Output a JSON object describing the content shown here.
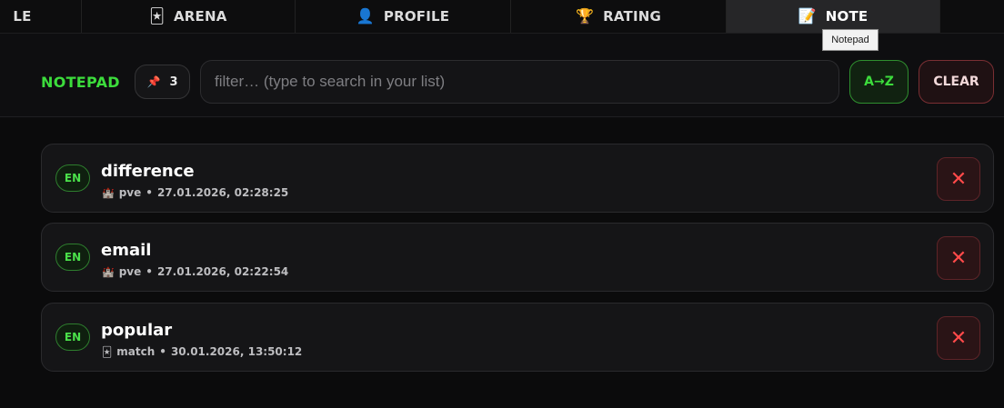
{
  "tabs": [
    {
      "label": "LE",
      "icon": "",
      "active": false
    },
    {
      "label": "ARENA",
      "icon": "🃏",
      "active": false
    },
    {
      "label": "PROFILE",
      "icon": "👤",
      "active": false
    },
    {
      "label": "RATING",
      "icon": "🏆",
      "active": false
    },
    {
      "label": "NOTE",
      "icon": "📝",
      "active": true
    }
  ],
  "tooltip": "Notepad",
  "notepad": {
    "title": "NOTEPAD",
    "count_icon": "📌",
    "count": "3",
    "filter_placeholder": "filter… (type to search in your list)",
    "filter_value": "",
    "sort_label": "A→Z",
    "clear_label": "CLEAR"
  },
  "entries": [
    {
      "lang": "EN",
      "word": "difference",
      "mode_icon": "🏰",
      "mode": "pve",
      "timestamp": "27.01.2026, 02:28:25",
      "delete": "✕"
    },
    {
      "lang": "EN",
      "word": "email",
      "mode_icon": "🏰",
      "mode": "pve",
      "timestamp": "27.01.2026, 02:22:54",
      "delete": "✕"
    },
    {
      "lang": "EN",
      "word": "popular",
      "mode_icon": "🃏",
      "mode": "match",
      "timestamp": "30.01.2026, 13:50:12",
      "delete": "✕"
    }
  ],
  "colors": {
    "accent_green": "#3cdc3c",
    "danger_red": "#ff4a4a",
    "background": "#0c0c0d"
  }
}
